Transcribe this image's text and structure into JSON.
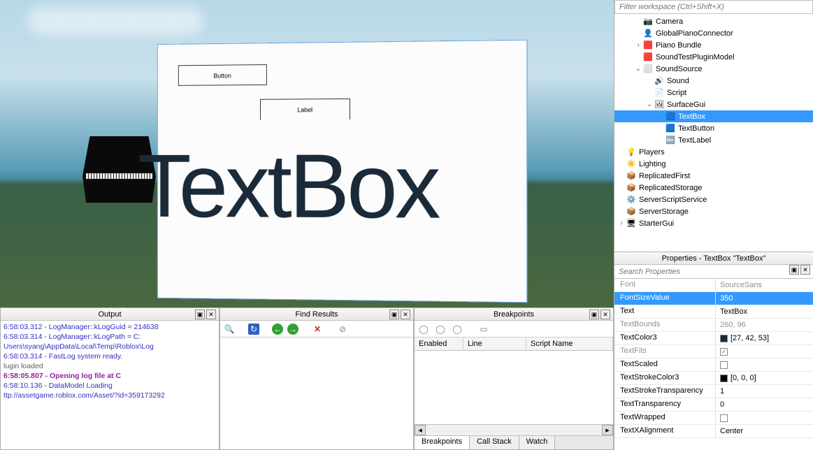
{
  "viewport": {
    "gui_button": "Button",
    "gui_label": "Label",
    "gui_textbox": "TextBox"
  },
  "explorer": {
    "filter_placeholder": "Filter workspace (Ctrl+Shift+X)",
    "items": [
      {
        "ind": 1,
        "exp": "",
        "ico": "📷",
        "label": "Camera",
        "sel": false
      },
      {
        "ind": 1,
        "exp": "",
        "ico": "👤",
        "label": "GlobalPianoConnector",
        "sel": false
      },
      {
        "ind": 1,
        "exp": "›",
        "ico": "🟥",
        "label": "Piano Bundle",
        "sel": false
      },
      {
        "ind": 1,
        "exp": "",
        "ico": "🟥",
        "label": "SoundTestPluginModel",
        "sel": false
      },
      {
        "ind": 1,
        "exp": "⌄",
        "ico": "⬜",
        "label": "SoundSource",
        "sel": false
      },
      {
        "ind": 2,
        "exp": "",
        "ico": "🔊",
        "label": "Sound",
        "sel": false
      },
      {
        "ind": 2,
        "exp": "",
        "ico": "📄",
        "label": "Script",
        "sel": false
      },
      {
        "ind": 2,
        "exp": "⌄",
        "ico": "🖼",
        "label": "SurfaceGui",
        "sel": false
      },
      {
        "ind": 3,
        "exp": "",
        "ico": "🟦",
        "label": "TextBox",
        "sel": true
      },
      {
        "ind": 3,
        "exp": "",
        "ico": "🟦",
        "label": "TextButton",
        "sel": false
      },
      {
        "ind": 3,
        "exp": "",
        "ico": "🔤",
        "label": "TextLabel",
        "sel": false
      },
      {
        "ind": 0,
        "exp": "",
        "ico": "💡",
        "label": "Players",
        "sel": false
      },
      {
        "ind": 0,
        "exp": "",
        "ico": "☀️",
        "label": "Lighting",
        "sel": false
      },
      {
        "ind": 0,
        "exp": "",
        "ico": "📦",
        "label": "ReplicatedFirst",
        "sel": false
      },
      {
        "ind": 0,
        "exp": "",
        "ico": "📦",
        "label": "ReplicatedStorage",
        "sel": false
      },
      {
        "ind": 0,
        "exp": "",
        "ico": "⚙️",
        "label": "ServerScriptService",
        "sel": false
      },
      {
        "ind": 0,
        "exp": "",
        "ico": "📦",
        "label": "ServerStorage",
        "sel": false
      },
      {
        "ind": 0,
        "exp": "›",
        "ico": "🖥",
        "label": "StarterGui",
        "sel": false
      }
    ]
  },
  "properties": {
    "title": "Properties - TextBox \"TextBox\"",
    "search_placeholder": "Search Properties",
    "rows": [
      {
        "name": "Font",
        "val": "SourceSans",
        "ro": true
      },
      {
        "name": "FontSizeValue",
        "val": "350",
        "sel": true
      },
      {
        "name": "Text",
        "val": "TextBox"
      },
      {
        "name": "TextBounds",
        "val": "260, 96",
        "ro": true
      },
      {
        "name": "TextColor3",
        "val": "[27, 42, 53]",
        "swatch": "#1b2a35"
      },
      {
        "name": "TextFits",
        "val": "",
        "ro": true,
        "check": true,
        "checked": true
      },
      {
        "name": "TextScaled",
        "val": "",
        "check": true,
        "checked": false
      },
      {
        "name": "TextStrokeColor3",
        "val": "[0, 0, 0]",
        "swatch": "#000000"
      },
      {
        "name": "TextStrokeTransparency",
        "val": "1"
      },
      {
        "name": "TextTransparency",
        "val": "0"
      },
      {
        "name": "TextWrapped",
        "val": "",
        "check": true,
        "checked": false
      },
      {
        "name": "TextXAlignment",
        "val": "Center"
      }
    ]
  },
  "output": {
    "title": "Output",
    "lines": [
      {
        "cls": "",
        "t": "6:58:03.312 - LogManager::kLogGuid = 214638"
      },
      {
        "cls": "",
        "t": "6:58:03.314 - LogManager::kLogPath = C:"
      },
      {
        "cls": "",
        "t": "Users\\syang\\AppData\\Local\\Temp\\Roblox\\Log"
      },
      {
        "cls": "",
        "t": "6:58:03.314 - FastLog system ready."
      },
      {
        "cls": "sys",
        "t": "lugin loaded"
      },
      {
        "cls": "warn",
        "t": "6:58:05.807 - Opening log file at C"
      },
      {
        "cls": "",
        "t": "6:58:10.136 - DataModel Loading"
      },
      {
        "cls": "",
        "t": "ttp://assetgame.roblox.com/Asset/?id=359173292"
      }
    ]
  },
  "find": {
    "title": "Find Results"
  },
  "breakpoints": {
    "title": "Breakpoints",
    "columns": [
      "Enabled",
      "Line",
      "Script Name"
    ],
    "tabs": [
      "Breakpoints",
      "Call Stack",
      "Watch"
    ]
  }
}
